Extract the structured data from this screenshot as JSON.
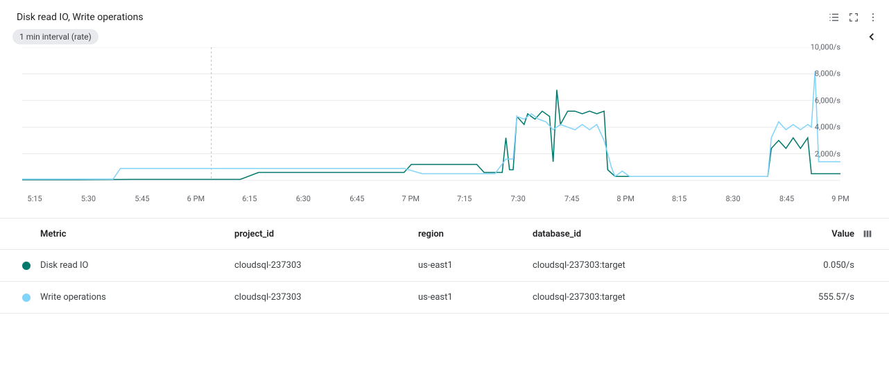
{
  "title": "Disk read IO, Write operations",
  "interval_chip": "1 min interval (rate)",
  "chart_data": {
    "type": "line",
    "xlabel": "",
    "ylabel": "",
    "ylim": [
      0,
      10000
    ],
    "y_ticks": [
      "10,000/s",
      "8,000/s",
      "6,000/s",
      "4,000/s",
      "2,000/s"
    ],
    "x_ticks": [
      "5:15",
      "5:30",
      "5:45",
      "6 PM",
      "6:15",
      "6:30",
      "6:45",
      "7 PM",
      "7:15",
      "7:30",
      "7:45",
      "8 PM",
      "8:15",
      "8:30",
      "8:45",
      "9 PM"
    ],
    "cursor_x": "6:07",
    "series": [
      {
        "name": "Disk read IO",
        "color": "#00796b",
        "points": [
          [
            "5:15",
            50
          ],
          [
            "5:30",
            50
          ],
          [
            "5:45",
            80
          ],
          [
            "6:00",
            80
          ],
          [
            "6:15",
            80
          ],
          [
            "6:20",
            600
          ],
          [
            "6:30",
            600
          ],
          [
            "6:45",
            600
          ],
          [
            "7:00",
            600
          ],
          [
            "7:02",
            1200
          ],
          [
            "7:15",
            1200
          ],
          [
            "7:20",
            1200
          ],
          [
            "7:22",
            600
          ],
          [
            "7:27",
            600
          ],
          [
            "7:28",
            3200
          ],
          [
            "7:29",
            800
          ],
          [
            "7:30",
            800
          ],
          [
            "7:31",
            4800
          ],
          [
            "7:33",
            4200
          ],
          [
            "7:34",
            5000
          ],
          [
            "7:36",
            4600
          ],
          [
            "7:38",
            5200
          ],
          [
            "7:40",
            4800
          ],
          [
            "7:41",
            1400
          ],
          [
            "7:42",
            6800
          ],
          [
            "7:43",
            4200
          ],
          [
            "7:45",
            5200
          ],
          [
            "7:47",
            5200
          ],
          [
            "7:49",
            5000
          ],
          [
            "7:51",
            5200
          ],
          [
            "7:53",
            5000
          ],
          [
            "7:55",
            5200
          ],
          [
            "7:56",
            800
          ],
          [
            "7:58",
            300
          ],
          [
            "8:00",
            300
          ],
          [
            "8:15",
            300
          ],
          [
            "8:30",
            300
          ],
          [
            "8:40",
            300
          ],
          [
            "8:41",
            2400
          ],
          [
            "8:43",
            3000
          ],
          [
            "8:45",
            2400
          ],
          [
            "8:47",
            3200
          ],
          [
            "8:49",
            2400
          ],
          [
            "8:51",
            3200
          ],
          [
            "8:52",
            500
          ],
          [
            "8:53",
            500
          ],
          [
            "8:54",
            500
          ],
          [
            "8:56",
            500
          ],
          [
            "9:00",
            500
          ]
        ]
      },
      {
        "name": "Write operations",
        "color": "#81d4fa",
        "points": [
          [
            "5:15",
            100
          ],
          [
            "5:30",
            100
          ],
          [
            "5:40",
            100
          ],
          [
            "5:42",
            900
          ],
          [
            "5:45",
            900
          ],
          [
            "6:00",
            900
          ],
          [
            "6:15",
            900
          ],
          [
            "6:30",
            900
          ],
          [
            "6:45",
            900
          ],
          [
            "7:00",
            900
          ],
          [
            "7:05",
            500
          ],
          [
            "7:10",
            500
          ],
          [
            "7:15",
            500
          ],
          [
            "7:20",
            500
          ],
          [
            "7:25",
            500
          ],
          [
            "7:28",
            1600
          ],
          [
            "7:30",
            1600
          ],
          [
            "7:31",
            4800
          ],
          [
            "7:33",
            4600
          ],
          [
            "7:35",
            5000
          ],
          [
            "7:37",
            4600
          ],
          [
            "7:39",
            4400
          ],
          [
            "7:41",
            3800
          ],
          [
            "7:43",
            4200
          ],
          [
            "7:45",
            4000
          ],
          [
            "7:47",
            3800
          ],
          [
            "7:49",
            4200
          ],
          [
            "7:51",
            3800
          ],
          [
            "7:53",
            4200
          ],
          [
            "7:55",
            3000
          ],
          [
            "7:57",
            1000
          ],
          [
            "7:58",
            300
          ],
          [
            "8:00",
            700
          ],
          [
            "8:02",
            300
          ],
          [
            "8:15",
            300
          ],
          [
            "8:30",
            300
          ],
          [
            "8:40",
            300
          ],
          [
            "8:41",
            3200
          ],
          [
            "8:43",
            4400
          ],
          [
            "8:45",
            3800
          ],
          [
            "8:47",
            4200
          ],
          [
            "8:49",
            3800
          ],
          [
            "8:51",
            4200
          ],
          [
            "8:52",
            4000
          ],
          [
            "8:53",
            8200
          ],
          [
            "8:54",
            1400
          ],
          [
            "8:56",
            1400
          ],
          [
            "9:00",
            1400
          ]
        ]
      }
    ]
  },
  "legend": {
    "headers": {
      "metric": "Metric",
      "project": "project_id",
      "region": "region",
      "db": "database_id",
      "value": "Value"
    },
    "rows": [
      {
        "color": "#00796b",
        "metric": "Disk read IO",
        "project": "cloudsql-237303",
        "region": "us-east1",
        "db": "cloudsql-237303:target",
        "value": "0.050/s"
      },
      {
        "color": "#81d4fa",
        "metric": "Write operations",
        "project": "cloudsql-237303",
        "region": "us-east1",
        "db": "cloudsql-237303:target",
        "value": "555.57/s"
      }
    ]
  }
}
